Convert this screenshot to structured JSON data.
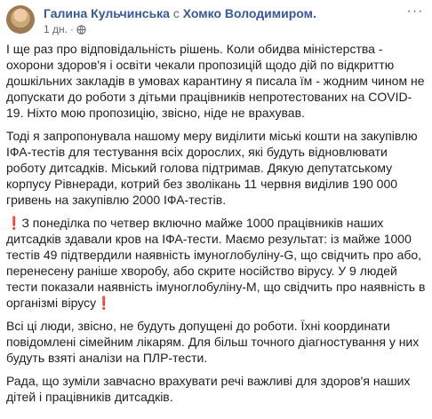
{
  "post": {
    "author": "Галина Кульчинська",
    "with_text": "с",
    "tagged": "Хомко Володимиром.",
    "time": "1 дн.",
    "separator": "·",
    "more_glyph": "···",
    "paragraphs": [
      {
        "text": "І ще раз про відповідальність рішень. Коли обидва міністерства - охорони здоров'я і освіти чекали пропозицій щодо дій по відкриттю дошкільних закладів в умовах карантину я писала їм - жодним чином не допускати до роботи з дітьми працівників непротестованих на COVID-19. Ніхто мою пропозицію, звісно, ніде не врахував."
      },
      {
        "text": "Тоді я запропонувала нашому меру виділити міські кошти на закупівлю ІФА-тестів для тестування всіх дорослих, які будуть відновлювати роботу дитсадків. Міський голова підтримав. Дякую депутатському корпусу Рівнеради, котрий без зволікань 11 червня виділив 190 000 гривень на закупівлю 2000 ІФА-тестів."
      },
      {
        "prefix": "❗",
        "text": "З понеділка по четвер включно майже 1000 працівників наших дитсадків здавали кров на ІФА-тести. Маємо результат: із майже 1000 тестів 49 підтвердили наявність імуноглобуліну-G, що свідчить про або, перенесену раніше хворобу, або скрите носійство вірусу. У 9 людей тести показали наявність імуноглобуліну-М, що свідчить про наявність в організмі вірусу",
        "suffix": "❗"
      },
      {
        "text": "Всі ці люди, звісно, не будуть допущені до роботи. Їхні координати повідомлені сімейним лікарям. Для більш точного діагностування у них будуть взяті аналізи на ПЛР-тести."
      },
      {
        "text": "Рада, що зуміли завчасно врахувати речі важливі для здоров'я наших дітей і працівників дитсадків."
      }
    ]
  },
  "icons": {
    "avatar": "avatar-photo",
    "privacy": "globe-icon",
    "more": "more-options-icon"
  },
  "colors": {
    "link": "#385898",
    "meta": "#616770",
    "text": "#1c1e21",
    "exclamation": "#e0202f"
  }
}
